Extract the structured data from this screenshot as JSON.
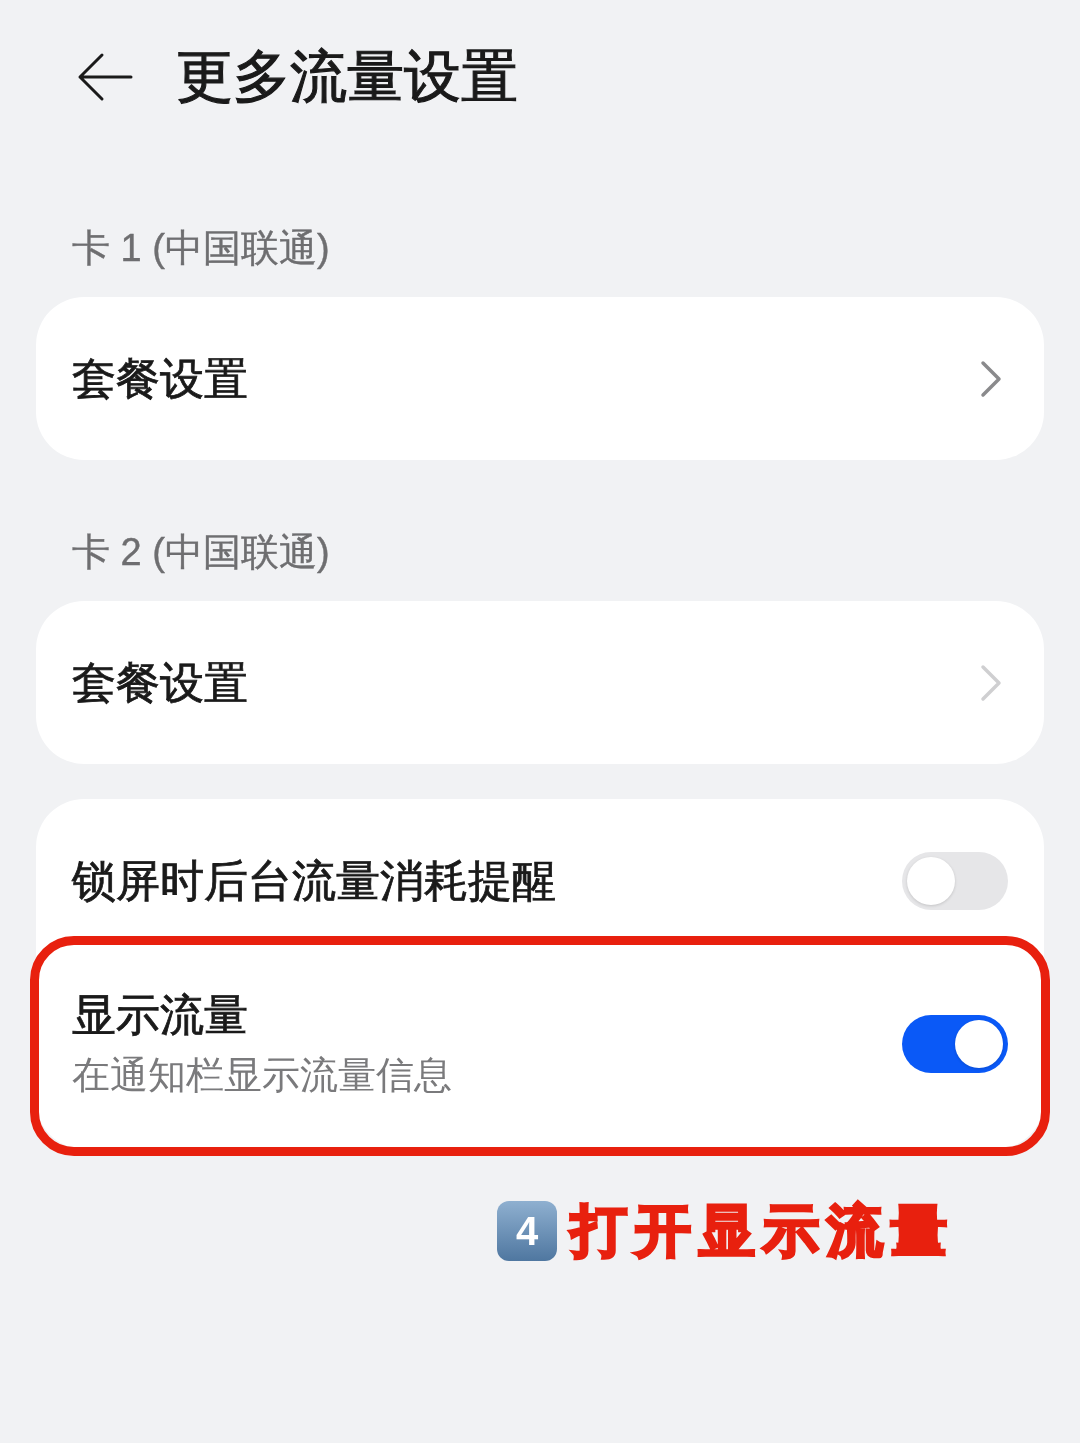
{
  "header": {
    "title": "更多流量设置"
  },
  "sections": [
    {
      "label": "卡 1 (中国联通)",
      "items": [
        {
          "kind": "link",
          "title": "套餐设置",
          "chevron_faded": false
        }
      ]
    },
    {
      "label": "卡 2 (中国联通)",
      "items": [
        {
          "kind": "link",
          "title": "套餐设置",
          "chevron_faded": true
        }
      ]
    },
    {
      "items": [
        {
          "kind": "switch",
          "title": "锁屏时后台流量消耗提醒",
          "on": false,
          "highlighted": false
        },
        {
          "kind": "switch",
          "title": "显示流量",
          "subtitle": "在通知栏显示流量信息",
          "on": true,
          "highlighted": true
        }
      ]
    }
  ],
  "annotation": {
    "step": "4",
    "text": "打开显示流量"
  }
}
